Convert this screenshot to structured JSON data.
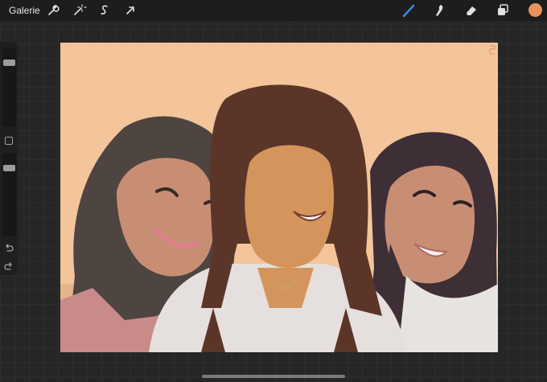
{
  "toolbar": {
    "gallery_label": "Galerie",
    "left_icons": [
      "wrench-icon",
      "magic-wand-icon",
      "selection-s-icon",
      "transform-arrow-icon"
    ],
    "right_icons": [
      "brush-icon",
      "smudge-icon",
      "eraser-icon",
      "layers-icon"
    ],
    "active_tool": "brush",
    "active_color": "#E8935B",
    "accent": "#3A8CF0"
  },
  "sidebar": {
    "brush_size_level": 0.15,
    "opacity_level": 0.15,
    "icons": [
      "modify-square-icon",
      "undo-icon",
      "redo-icon"
    ]
  },
  "canvas": {
    "background_color": "#F4C49A",
    "subject": "three-women-portrait"
  }
}
